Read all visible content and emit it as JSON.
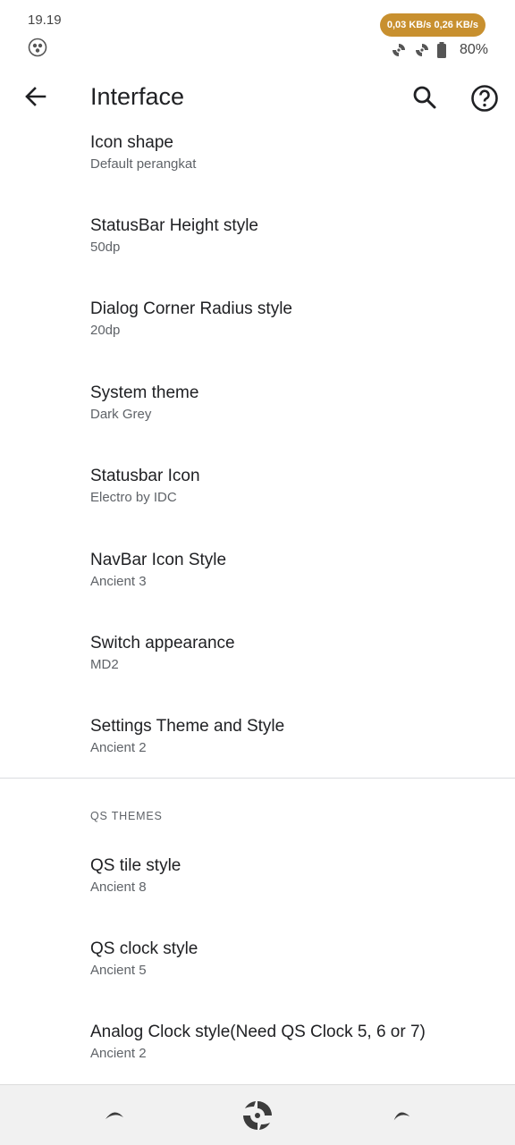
{
  "status_bar": {
    "time": "19.19",
    "network_speed": "0,03 KB/s 0,26 KB/s",
    "battery": "80%"
  },
  "app_bar": {
    "title": "Interface"
  },
  "items": [
    {
      "title": "Icon shape",
      "subtitle": "Default perangkat"
    },
    {
      "title": "StatusBar Height style",
      "subtitle": "50dp"
    },
    {
      "title": "Dialog Corner Radius style",
      "subtitle": "20dp"
    },
    {
      "title": "System theme",
      "subtitle": "Dark Grey"
    },
    {
      "title": "Statusbar Icon",
      "subtitle": "Electro by IDC"
    },
    {
      "title": "NavBar Icon Style",
      "subtitle": "Ancient 3"
    },
    {
      "title": "Switch appearance",
      "subtitle": "MD2"
    },
    {
      "title": "Settings Theme and Style",
      "subtitle": "Ancient 2"
    }
  ],
  "qs_section": {
    "header": "QS THEMES",
    "items": [
      {
        "title": "QS tile style",
        "subtitle": "Ancient 8"
      },
      {
        "title": "QS clock style",
        "subtitle": "Ancient 5"
      },
      {
        "title": "Analog Clock style(Need QS Clock 5, 6 or 7)",
        "subtitle": "Ancient 2"
      }
    ]
  },
  "colors": {
    "accent_pill": "#c8902f",
    "text_primary": "#202124",
    "text_secondary": "#5f6368"
  },
  "icons": {
    "back": "arrow-left-icon",
    "search": "search-icon",
    "help": "help-circle-icon",
    "nav_back": "nav-back-icon",
    "nav_home": "nav-home-icon",
    "nav_recents": "nav-recents-icon"
  }
}
